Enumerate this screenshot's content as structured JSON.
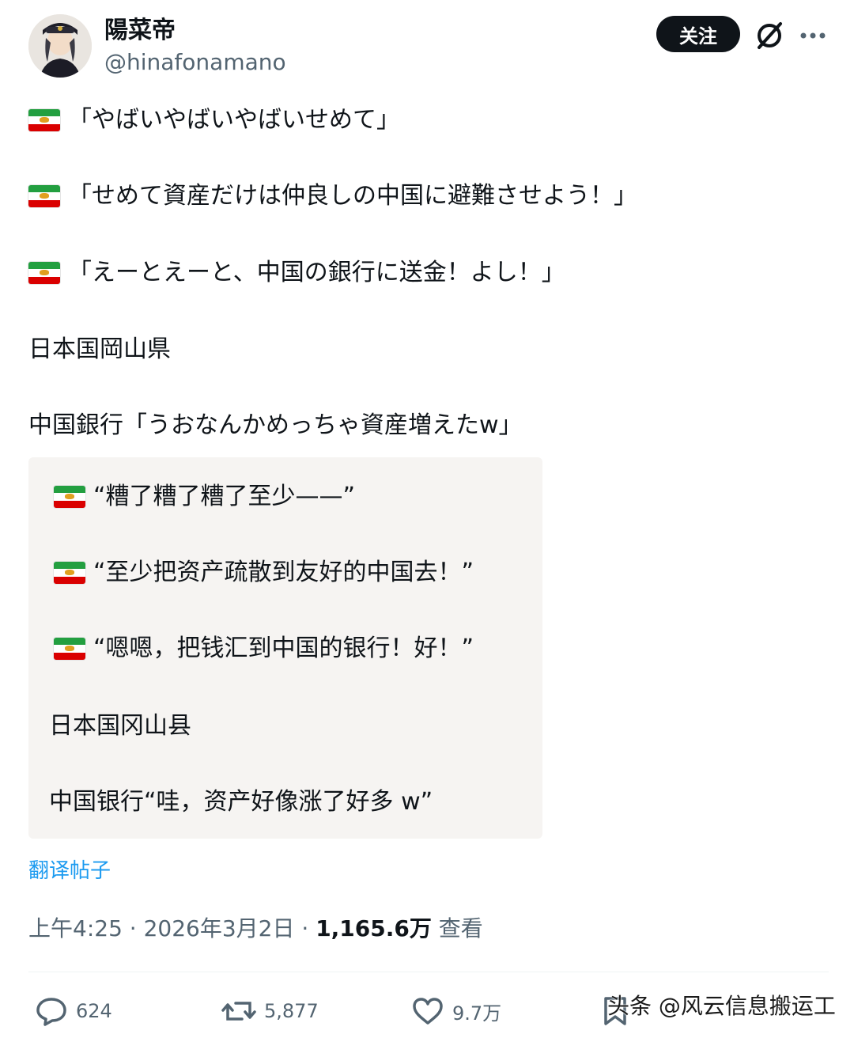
{
  "author": {
    "display_name": "陽菜帝",
    "handle": "@hinafonamano"
  },
  "header": {
    "follow_label": "关注"
  },
  "tweet": {
    "lines": [
      "「やばいやばいやばいせめて」",
      "「せめて資産だけは仲良しの中国に避難させよう！」",
      "「えーとえーと、中国の銀行に送金！よし！」",
      "日本国岡山県",
      "中国銀行「うおなんかめっちゃ資産増えたw」"
    ]
  },
  "translation_box": {
    "lines": [
      "“糟了糟了糟了至少——”",
      "“至少把资产疏散到友好的中国去！”",
      "“嗯嗯，把钱汇到中国的银行！好！”",
      "日本国冈山县",
      "中国银行“哇，资产好像涨了好多 w”"
    ]
  },
  "translate_link": "翻译帖子",
  "meta": {
    "time": "上午4:25",
    "date": "2026年3月2日",
    "views": "1,165.6万",
    "views_label": "查看",
    "separator": " · "
  },
  "actions": {
    "replies": "624",
    "reposts": "5,877",
    "likes": "9.7万"
  },
  "watermark": "头条 @风云信息搬运工",
  "icons": [
    "grok-icon",
    "more-icon",
    "reply-icon",
    "repost-icon",
    "like-icon",
    "bookmark-icon",
    "iran-flag-icon"
  ],
  "colors": {
    "text": "#0f1419",
    "secondary": "#536471",
    "link": "#1d9bf0",
    "follow_bg": "#0f1419",
    "quote_bg": "#f6f4f2"
  }
}
